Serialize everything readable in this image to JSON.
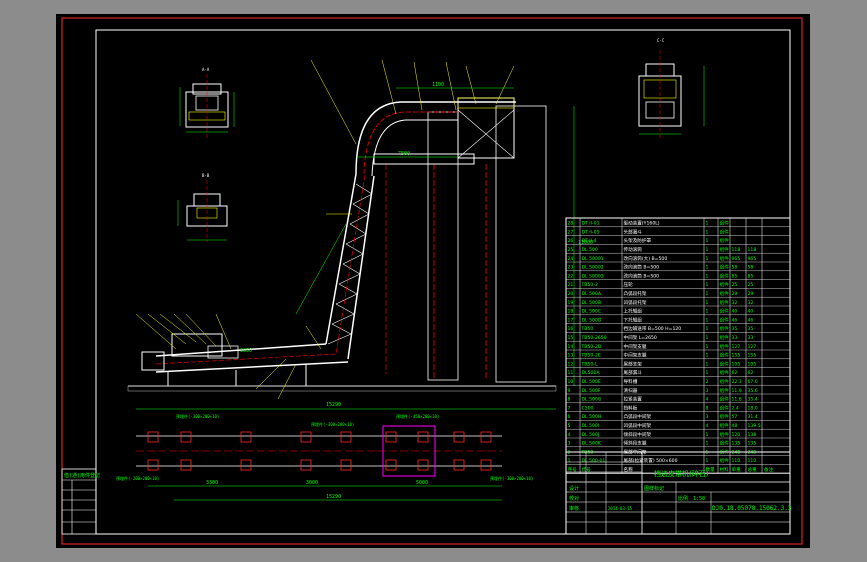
{
  "colors": {
    "background": "#000000",
    "outer": "#8c8c8c",
    "frame_red": "#ff2a2a",
    "frame_white": "#ffffff",
    "dim_green": "#00ff00",
    "leader_yellow": "#ffff00",
    "center_red": "#ff0000",
    "machine_white": "#ffffff",
    "cyan": "#00ffff",
    "magenta": "#ff00ff",
    "hatch_gray": "#bdbdbd"
  },
  "views": {
    "side_view": {
      "label": "side-elevation-view"
    },
    "plan_view": {
      "label": "foundation-plan-view"
    },
    "section_a": {
      "label": "A-A"
    },
    "section_b": {
      "label": "B-B"
    },
    "section_c": {
      "label": "C-C"
    }
  },
  "dims": {
    "overall_length": "15290",
    "center_bottom": "7500",
    "head_width": "1100",
    "lower_run": "3050",
    "height": "11000",
    "plan_left": "3300",
    "plan_mid": "3000",
    "plan_right": "5000",
    "plan_total": "15290"
  },
  "plan_notes": {
    "left_top": "预埋件(-300×200×10)",
    "mid_top": "预埋件(-450×200×10)",
    "right_top": "预埋件(-300×200×10)",
    "left_bottom": "预埋件(-200×200×10)",
    "right_bottom": "预埋件(-300×200×10)"
  },
  "bom_rows": [
    {
      "no": "28",
      "code": "DT II-01",
      "name": "驱动装置(Y160L)",
      "qty": "1",
      "mat": "组件",
      "w": "",
      "tw": ""
    },
    {
      "no": "27",
      "code": "DT II-05",
      "name": "头部漏斗",
      "qty": "1",
      "mat": "组件",
      "w": "",
      "tw": ""
    },
    {
      "no": "26",
      "code": "DT II-4",
      "name": "头架及防护罩",
      "qty": "1",
      "mat": "组件",
      "w": "",
      "tw": ""
    },
    {
      "no": "25",
      "code": "DL 500",
      "name": "传动滚筒",
      "qty": "1",
      "mat": "组件",
      "w": "118",
      "tw": "118"
    },
    {
      "no": "24",
      "code": "DL 50001",
      "name": "改向滚筒(大) B=500",
      "qty": "1",
      "mat": "组件",
      "w": "965",
      "tw": "965"
    },
    {
      "no": "23",
      "code": "DL 50002",
      "name": "改向滚筒 B=500",
      "qty": "1",
      "mat": "组件",
      "w": "58",
      "tw": "58"
    },
    {
      "no": "22",
      "code": "DL 50003",
      "name": "改向滚筒 B=500",
      "qty": "1",
      "mat": "组件",
      "w": "85",
      "tw": "85"
    },
    {
      "no": "21",
      "code": "TB50-2",
      "name": "压轮",
      "qty": "1",
      "mat": "组件",
      "w": "25",
      "tw": "25"
    },
    {
      "no": "20",
      "code": "DL 500A",
      "name": "凸弧段托架",
      "qty": "1",
      "mat": "组件",
      "w": "29",
      "tw": "29"
    },
    {
      "no": "19",
      "code": "DL 500B",
      "name": "凹弧段托架",
      "qty": "1",
      "mat": "组件",
      "w": "32",
      "tw": "32"
    },
    {
      "no": "18",
      "code": "DL 500C",
      "name": "上托辊组",
      "qty": "1",
      "mat": "组件",
      "w": "40",
      "tw": "40"
    },
    {
      "no": "17",
      "code": "DL 500D",
      "name": "下托辊组",
      "qty": "1",
      "mat": "组件",
      "w": "46",
      "tw": "46"
    },
    {
      "no": "16",
      "code": "TB50",
      "name": "挡边输送带 B=500 H=120",
      "qty": "1",
      "mat": "组件",
      "w": "35",
      "tw": "35"
    },
    {
      "no": "15",
      "code": "TB50-2650",
      "name": "中间架 L=2650",
      "qty": "1",
      "mat": "组件",
      "w": "33",
      "tw": "33"
    },
    {
      "no": "14",
      "code": "TB50-2D",
      "name": "中间架支腿",
      "qty": "1",
      "mat": "组件",
      "w": "127",
      "tw": "127"
    },
    {
      "no": "13",
      "code": "TB50-2E",
      "name": "中间架支腿",
      "qty": "1",
      "mat": "组件",
      "w": "155",
      "tw": "155"
    },
    {
      "no": "12",
      "code": "TB50-L",
      "name": "尾部支架",
      "qty": "1",
      "mat": "组件",
      "w": "105",
      "tw": "105"
    },
    {
      "no": "11",
      "code": "DL500A",
      "name": "尾部漏斗",
      "qty": "1",
      "mat": "组件",
      "w": "62",
      "tw": "62"
    },
    {
      "no": "10",
      "code": "DL 500E",
      "name": "导料槽",
      "qty": "2",
      "mat": "组件",
      "w": "22.3",
      "tw": "67.0"
    },
    {
      "no": "9",
      "code": "DL 500F",
      "name": "清扫器",
      "qty": "3",
      "mat": "组件",
      "w": "11.9",
      "tw": "35.6"
    },
    {
      "no": "8",
      "code": "DL 500G",
      "name": "拉紧装置",
      "qty": "4",
      "mat": "组件",
      "w": "11.8",
      "tw": "35.4"
    },
    {
      "no": "7",
      "code": "C500",
      "name": "挡料板",
      "qty": "8",
      "mat": "组件",
      "w": "2.4",
      "tw": "18.0"
    },
    {
      "no": "6",
      "code": "DL 500H",
      "name": "凸弧段中间架",
      "qty": "3",
      "mat": "组件",
      "w": "57",
      "tw": "31.4"
    },
    {
      "no": "5",
      "code": "DL 500I",
      "name": "凹弧段中间架",
      "qty": "4",
      "mat": "组件",
      "w": "48",
      "tw": "139.5"
    },
    {
      "no": "4",
      "code": "DL 500J",
      "name": "倾斜段中间架",
      "qty": "1",
      "mat": "组件",
      "w": "120",
      "tw": "138"
    },
    {
      "no": "3",
      "code": "DL 500K",
      "name": "倾斜段支腿",
      "qty": "1",
      "mat": "组件",
      "w": "135",
      "tw": "135"
    },
    {
      "no": "2",
      "code": "TB50",
      "name": "尾部中间架",
      "qty": "1",
      "mat": "组件",
      "w": "240",
      "tw": "240"
    },
    {
      "no": "1",
      "code": "DL 500-01",
      "name": "尾部(拉紧装置) 500×600",
      "qty": "1",
      "mat": "组件",
      "w": "110",
      "tw": "110"
    }
  ],
  "bom_header": {
    "no": "序号",
    "code": "代号",
    "name": "名称",
    "qty": "数量",
    "mat": "材料",
    "w": "单重",
    "tw": "总重",
    "note": "备注"
  },
  "title_block": {
    "drawing_title": "挡边皮带机(碎石)",
    "drawing_no": "DJ0.18.05078.15062.3.3",
    "scale": "1:50",
    "scale_label": "比例",
    "sheet_label": "图样标记",
    "designer": "设计",
    "checker": "校对",
    "approver": "审核",
    "date": "2014-03-15"
  },
  "revision_block": {
    "title": "借(通)用件登记",
    "rows": [
      "",
      "",
      "",
      "",
      "",
      ""
    ]
  }
}
